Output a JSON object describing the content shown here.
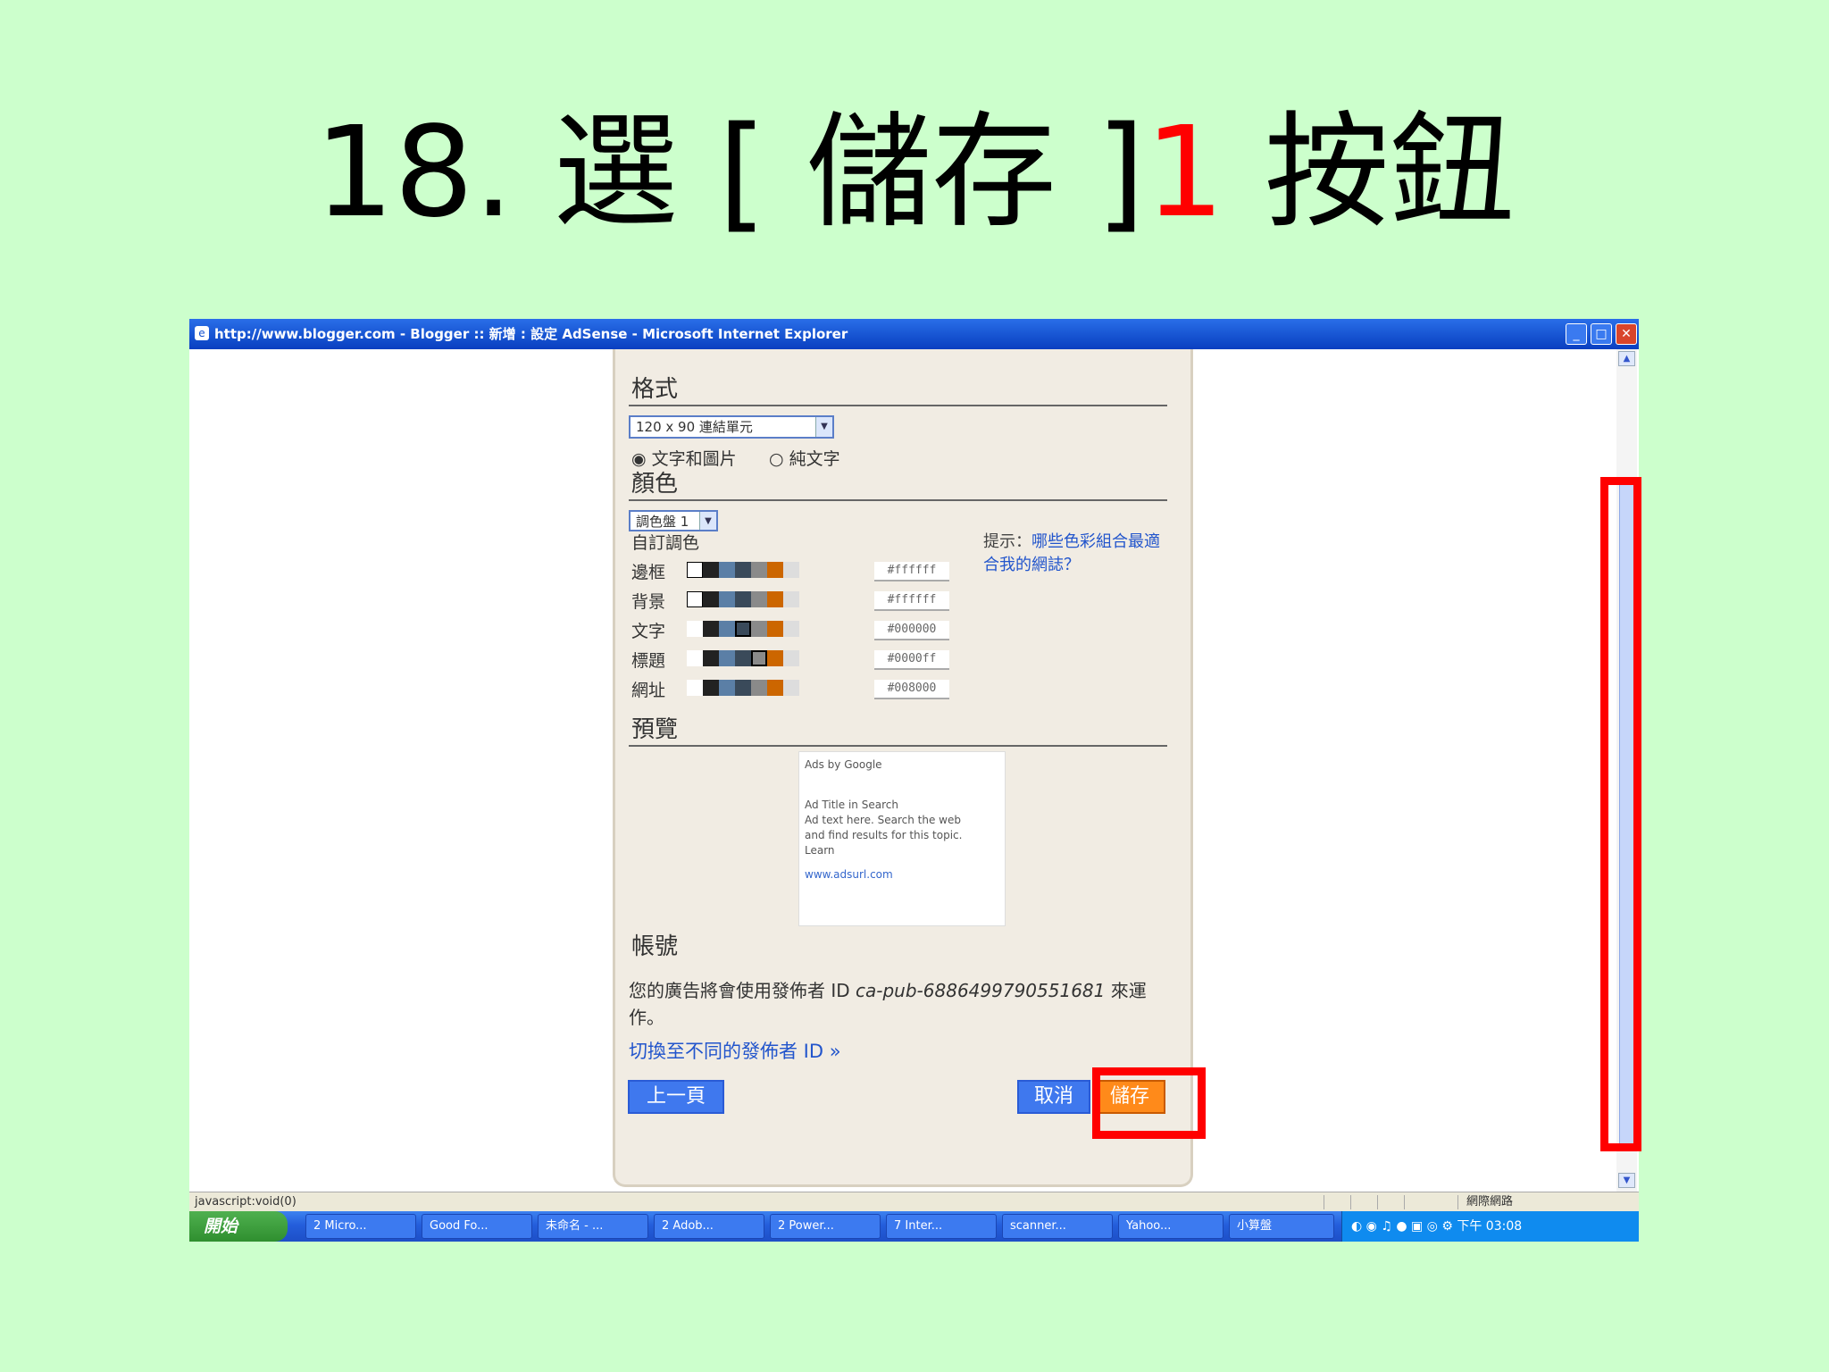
{
  "slide": {
    "title_prefix": "18. 選 [ 儲存 ]",
    "title_number": "1",
    "title_suffix": " 按鈕"
  },
  "browser": {
    "window_title": "http://www.blogger.com - Blogger :: 新增 : 設定 AdSense - Microsoft Internet Explorer",
    "status_text": "javascript:void(0)",
    "status_zone": "網際網路"
  },
  "panel": {
    "format": {
      "heading": "格式",
      "select_value": "120 x 90 連結單元",
      "radio_1": "文字和圖片",
      "radio_2": "純文字"
    },
    "color": {
      "heading": "顏色",
      "palette_select": "調色盤 1",
      "custom_label": "自訂調色",
      "rows": [
        {
          "label": "邊框",
          "hex": "#ffffff"
        },
        {
          "label": "背景",
          "hex": "#ffffff"
        },
        {
          "label": "文字",
          "hex": "#000000"
        },
        {
          "label": "標題",
          "hex": "#0000ff"
        },
        {
          "label": "網址",
          "hex": "#008000"
        }
      ],
      "tip_text": "提示：",
      "tip_link": "哪些色彩組合最適合我的網誌？"
    },
    "preview": {
      "heading": "預覽",
      "line1": "Ads by Google",
      "line2": "Ad Title in Search",
      "line3": "Ad text here. Search the web",
      "line4": "and find results for this topic.",
      "line5": "Learn",
      "line6": "www.adsurl.com"
    },
    "publisher": {
      "heading": "帳號",
      "text_pre": "您的廣告將會使用發佈者 ID ",
      "pub_id": "ca-pub-6886499790551681",
      "text_post": " 來運作。",
      "switch_link": "切換至不同的發佈者 ID »"
    },
    "buttons": {
      "prev": "上一頁",
      "cancel": "取消",
      "save": "儲存"
    }
  },
  "taskbar": {
    "start": "開始",
    "items": [
      "2 Micro...",
      "Good Fo...",
      "未命名 - ...",
      "2 Adob...",
      "2 Power...",
      "7 Inter...",
      "scanner...",
      "Yahoo...",
      "小算盤"
    ],
    "clock": "下午 03:08"
  },
  "colors": {
    "slide_bg": "#ccffcc",
    "highlight": "#ff0000",
    "save_button": "#ff8a1a",
    "primary_button": "#3f78ee"
  }
}
